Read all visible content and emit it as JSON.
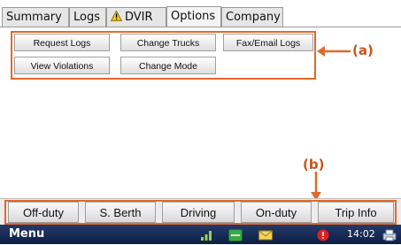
{
  "tabs": [
    {
      "label": "Summary"
    },
    {
      "label": "Logs"
    },
    {
      "label": "DVIR",
      "icon": "warning-icon"
    },
    {
      "label": "Options",
      "active": true
    },
    {
      "label": "Company"
    }
  ],
  "options": {
    "buttons": [
      {
        "label": "Request Logs"
      },
      {
        "label": "Change Trucks"
      },
      {
        "label": "Fax/Email Logs"
      },
      {
        "label": "View Violations"
      },
      {
        "label": "Change Mode"
      }
    ]
  },
  "annotations": {
    "a": "(a)",
    "b": "(b)"
  },
  "status_buttons": [
    {
      "label": "Off-duty"
    },
    {
      "label": "S. Berth"
    },
    {
      "label": "Driving"
    },
    {
      "label": "On-duty"
    },
    {
      "label": "Trip Info"
    }
  ],
  "taskbar": {
    "menu_label": "Menu",
    "clock": "14:02",
    "icons": [
      "signal-icon",
      "hos-icon",
      "mail-icon",
      "alert-icon",
      "printer-icon"
    ]
  },
  "colors": {
    "annotation": "#e06a2d",
    "taskbar": "#1a2c57",
    "alert": "#e02020"
  }
}
